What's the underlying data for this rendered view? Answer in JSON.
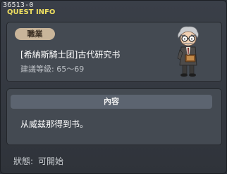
{
  "window": {
    "id": "36513-0",
    "title": "QUEST INFO"
  },
  "quest": {
    "job_label": "職業",
    "name": "[希納斯騎士团]古代研究书",
    "level_range": "建議等級: 65～69"
  },
  "content": {
    "header": "內容",
    "text": "从威兹那得到书。"
  },
  "status": {
    "label": "狀態:",
    "value": "可開始"
  },
  "npc": {
    "icon": "old-scholar-npc-sprite"
  }
}
